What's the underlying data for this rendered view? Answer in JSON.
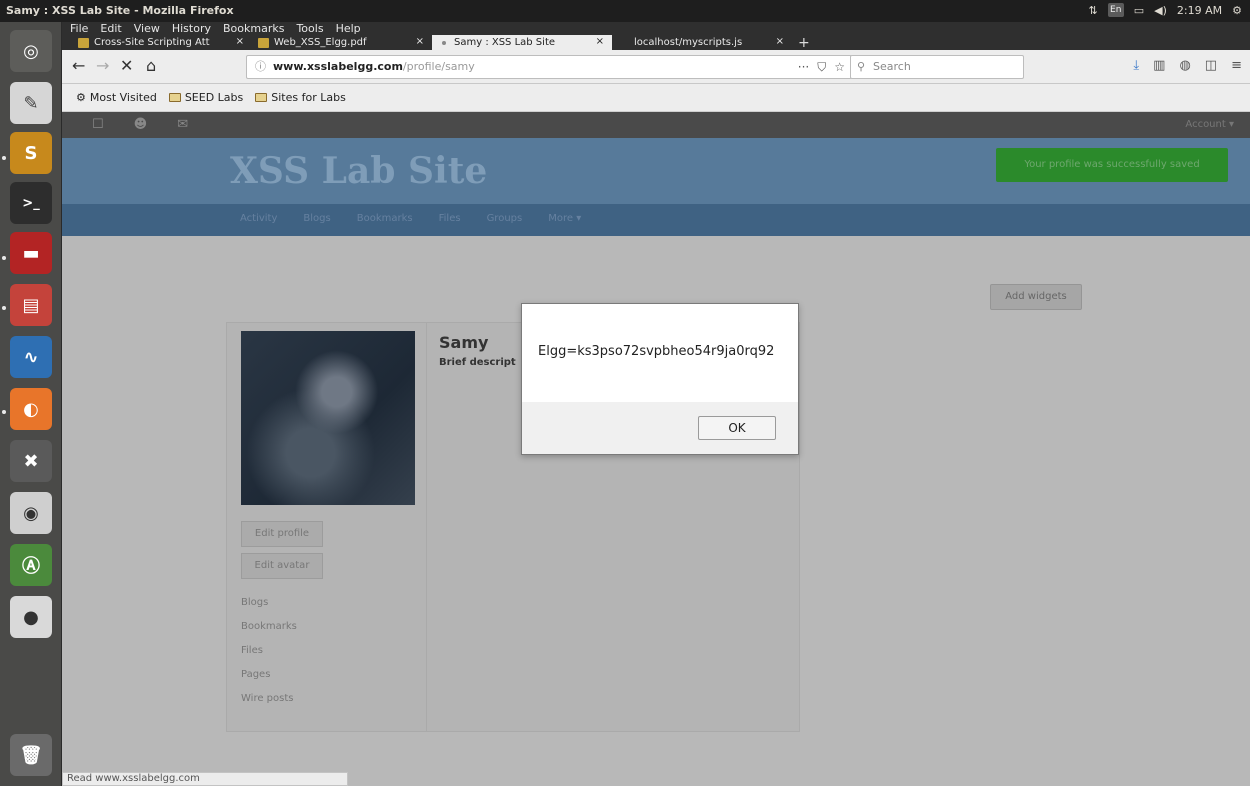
{
  "system": {
    "window_title": "Samy : XSS Lab Site - Mozilla Firefox",
    "clock": "2:19 AM",
    "tray_keyboard": "En"
  },
  "menu": [
    "File",
    "Edit",
    "View",
    "History",
    "Bookmarks",
    "Tools",
    "Help"
  ],
  "tabs": [
    {
      "label": "Cross-Site Scripting Att",
      "active": false
    },
    {
      "label": "Web_XSS_Elgg.pdf",
      "active": false
    },
    {
      "label": "Samy : XSS Lab Site",
      "active": true
    },
    {
      "label": "localhost/myscripts.js",
      "active": false
    }
  ],
  "url": {
    "host": "www.xsslabelgg.com",
    "path": "/profile/samy"
  },
  "search": {
    "placeholder": "Search"
  },
  "bookmarks": [
    "Most Visited",
    "SEED Labs",
    "Sites for Labs"
  ],
  "elgg": {
    "account": "Account",
    "site_title": "XSS Lab Site",
    "success_message": "Your profile was successfully saved",
    "nav": [
      "Activity",
      "Blogs",
      "Bookmarks",
      "Files",
      "Groups",
      "More"
    ],
    "add_widgets": "Add widgets",
    "profile_name": "Samy",
    "brief_label": "Brief descript",
    "side_buttons": [
      "Edit profile",
      "Edit avatar"
    ],
    "side_links": [
      "Blogs",
      "Bookmarks",
      "Files",
      "Pages",
      "Wire posts"
    ]
  },
  "alert": {
    "message": "Elgg=ks3pso72svpbheo54r9ja0rq92",
    "ok": "OK"
  },
  "status": "Read www.xsslabelgg.com"
}
